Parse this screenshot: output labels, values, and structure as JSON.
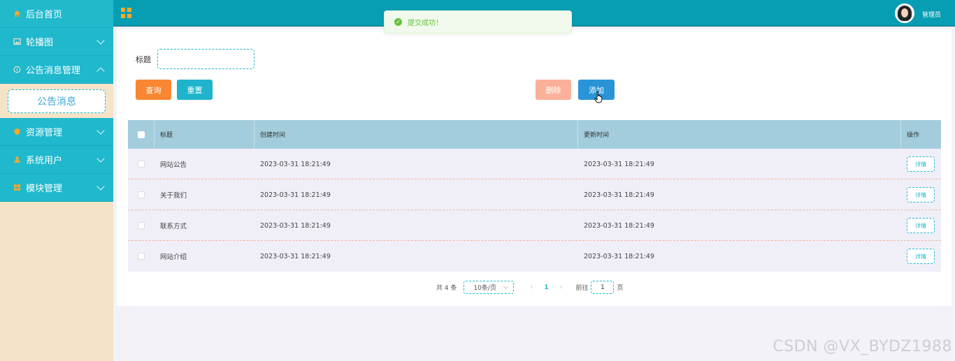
{
  "sidebar": {
    "items": [
      {
        "label": "后台首页",
        "icon": "home-icon"
      },
      {
        "label": "轮播图",
        "icon": "image-icon"
      },
      {
        "label": "公告消息管理",
        "icon": "info-icon"
      },
      {
        "label": "资源管理",
        "icon": "shield-icon"
      },
      {
        "label": "系统用户",
        "icon": "user-icon"
      },
      {
        "label": "模块管理",
        "icon": "grid-icon"
      }
    ],
    "submenu_active": "公告消息"
  },
  "header": {
    "admin_label": "管理员"
  },
  "toast": {
    "message": "提交成功！"
  },
  "search": {
    "title_label": "标题",
    "title_value": ""
  },
  "buttons": {
    "query": "查询",
    "reset": "重置",
    "delete": "删除",
    "add": "添加"
  },
  "table": {
    "headers": {
      "title": "标题",
      "created": "创建时间",
      "updated": "更新时间",
      "ops": "操作"
    },
    "rows": [
      {
        "title": "网站公告",
        "created": "2023-03-31 18:21:49",
        "updated": "2023-03-31 18:21:49",
        "action": "详情"
      },
      {
        "title": "关于我们",
        "created": "2023-03-31 18:21:49",
        "updated": "2023-03-31 18:21:49",
        "action": "详情"
      },
      {
        "title": "联系方式",
        "created": "2023-03-31 18:21:49",
        "updated": "2023-03-31 18:21:49",
        "action": "详情"
      },
      {
        "title": "网站介绍",
        "created": "2023-03-31 18:21:49",
        "updated": "2023-03-31 18:21:49",
        "action": "详情"
      }
    ]
  },
  "pagination": {
    "total": "共 4 条",
    "page_size": "10条/页",
    "current_page": "1",
    "goto_label": "前往",
    "goto_value": "1",
    "page_suffix": "页"
  },
  "watermark": "CSDN @VX_BYDZ1988",
  "colors": {
    "primary": "#1fb8cc",
    "header": "#079db3",
    "query": "#f88632",
    "delete": "#fbb09a",
    "add": "#2a94d8",
    "success": "#67c23a"
  }
}
